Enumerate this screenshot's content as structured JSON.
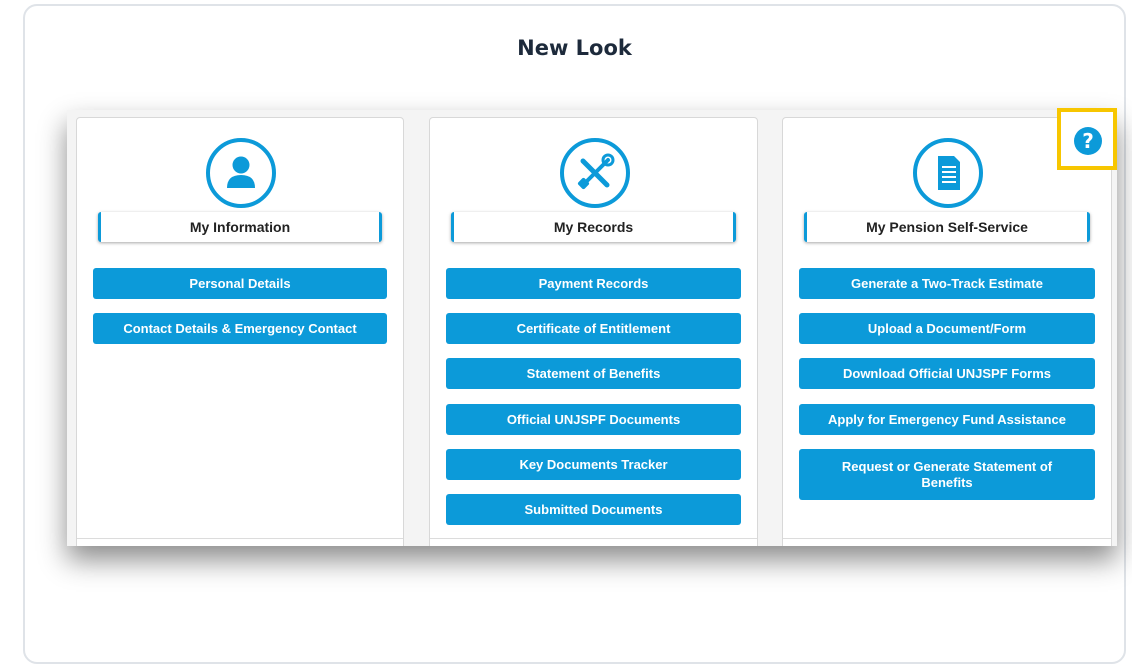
{
  "heading": "New Look",
  "cards": [
    {
      "title": "My Information",
      "icon": "person-icon",
      "buttons": [
        "Personal Details",
        "Contact Details & Emergency Contact"
      ]
    },
    {
      "title": "My Records",
      "icon": "tools-icon",
      "buttons": [
        "Payment Records",
        "Certificate of Entitlement",
        "Statement of Benefits",
        "Official UNJSPF Documents",
        "Key Documents Tracker",
        "Submitted Documents"
      ]
    },
    {
      "title": "My Pension Self-Service",
      "icon": "document-icon",
      "buttons": [
        "Generate a Two-Track Estimate",
        "Upload a Document/Form",
        "Download Official UNJSPF Forms",
        "Apply for Emergency Fund Assistance",
        "Request or Generate Statement of Benefits"
      ]
    }
  ],
  "help": {
    "icon": "help-icon",
    "glyph": "?"
  },
  "colors": {
    "accent": "#0c9ad9",
    "highlight": "#f7c600",
    "heading": "#1d2a3b"
  }
}
